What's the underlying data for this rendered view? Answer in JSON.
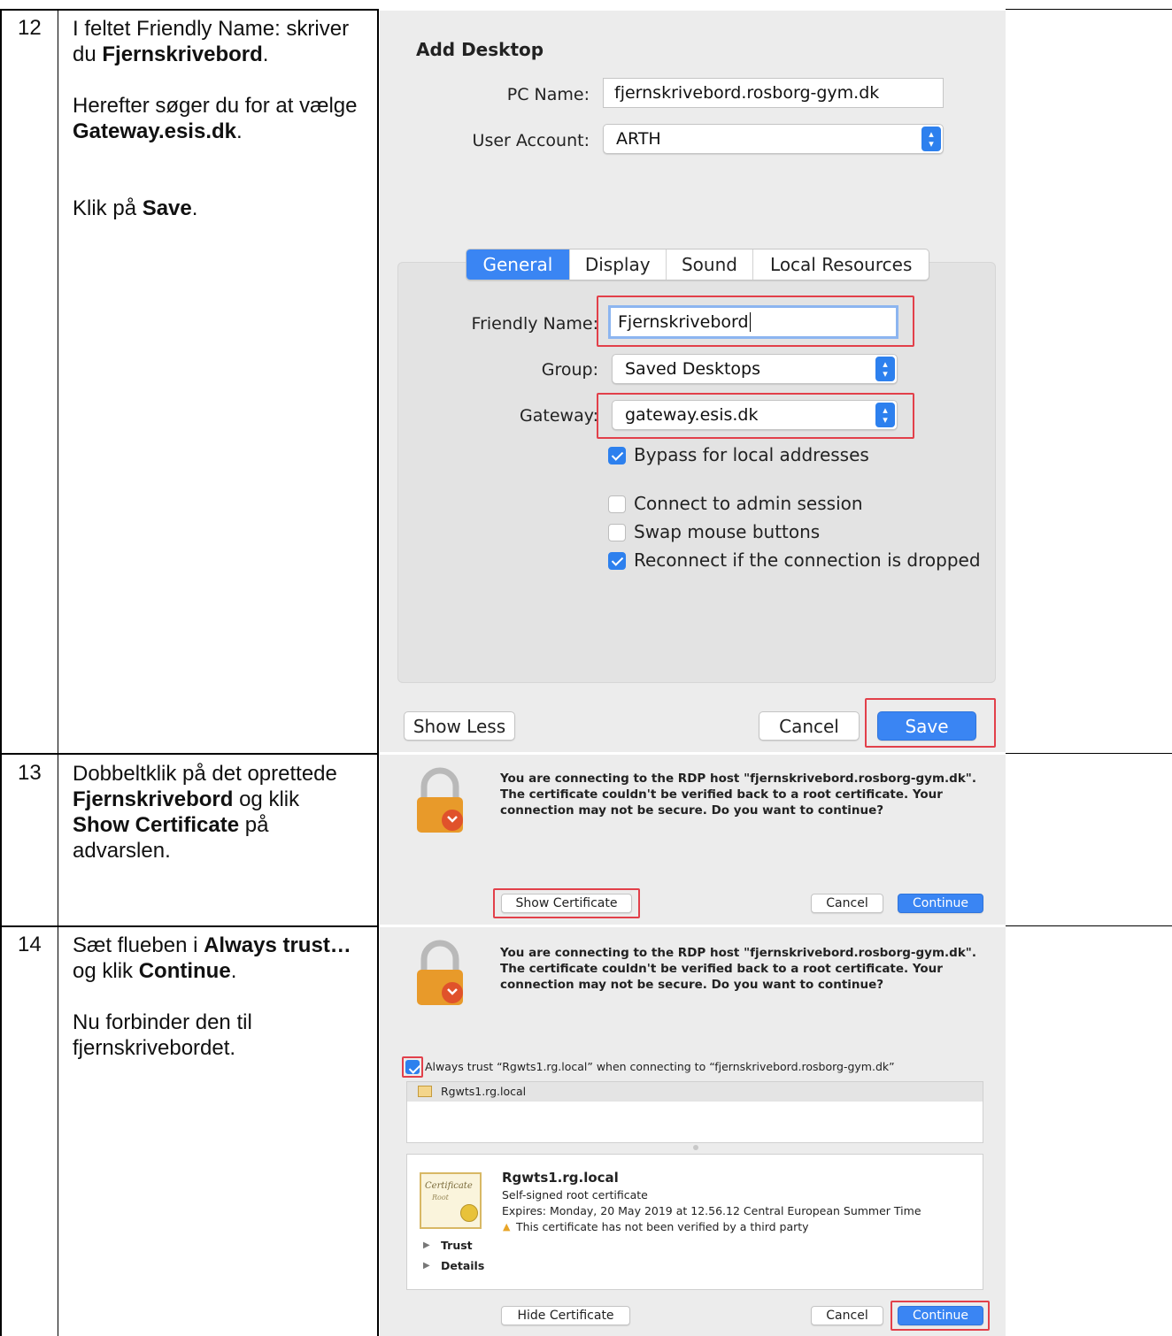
{
  "steps": [
    {
      "number": "12",
      "line1_prefix": "I feltet Friendly Name: skriver du ",
      "line1_bold": "Fjernskrivebord",
      "line1_suffix": ".",
      "line2_prefix": "Herefter søger du for at vælge ",
      "line2_bold": "Gateway.esis.dk",
      "line2_suffix": ".",
      "line3_prefix": "Klik på ",
      "line3_bold": "Save",
      "line3_suffix": "."
    },
    {
      "number": "13",
      "p1": "Dobbeltklik på det oprettede ",
      "b1": "Fjernskrivebord",
      "p2": " og klik ",
      "b2": "Show Certificate",
      "p3": " på advarslen."
    },
    {
      "number": "14",
      "p1": "Sæt flueben i ",
      "b1": "Always trust…",
      "p2": " og klik ",
      "b2": "Continue",
      "p3": ".",
      "line2": "Nu forbinder den til fjernskrivebordet."
    }
  ],
  "add_desktop": {
    "title": "Add Desktop",
    "pc_name_label": "PC Name:",
    "pc_name_value": "fjernskrivebord.rosborg-gym.dk",
    "user_account_label": "User Account:",
    "user_account_value": "ARTH",
    "tabs": [
      "General",
      "Display",
      "Sound",
      "Local Resources"
    ],
    "active_tab": "General",
    "friendly_name_label": "Friendly Name:",
    "friendly_name_value": "Fjernskrivebord",
    "group_label": "Group:",
    "group_value": "Saved Desktops",
    "gateway_label": "Gateway:",
    "gateway_value": "gateway.esis.dk",
    "checkboxes": [
      {
        "label": "Bypass for local addresses",
        "checked": true
      },
      {
        "label": "Connect to admin session",
        "checked": false
      },
      {
        "label": "Swap mouse buttons",
        "checked": false
      },
      {
        "label": "Reconnect if the connection is dropped",
        "checked": true
      }
    ],
    "show_less": "Show Less",
    "cancel": "Cancel",
    "save": "Save"
  },
  "cert_warning": {
    "message": "You are connecting to the RDP host \"fjernskrivebord.rosborg-gym.dk\". The certificate couldn't be verified back to a root certificate. Your connection may not be secure. Do you want to continue?",
    "show_certificate": "Show Certificate",
    "cancel": "Cancel",
    "continue": "Continue"
  },
  "cert_details": {
    "message": "You are connecting to the RDP host \"fjernskrivebord.rosborg-gym.dk\". The certificate couldn't be verified back to a root certificate. Your connection may not be secure. Do you want to continue?",
    "always_trust": "Always trust “Rgwts1.rg.local” when connecting to “fjernskrivebord.rosborg-gym.dk”",
    "always_trust_checked": true,
    "list_item": "Rgwts1.rg.local",
    "cert_name": "Rgwts1.rg.local",
    "cert_type": "Self-signed root certificate",
    "cert_expires": "Expires: Monday, 20 May 2019 at 12.56.12 Central European Summer Time",
    "cert_warning": "This certificate has not been verified by a third party",
    "cert_image_text": "Certificate",
    "cert_image_subtext": "Root",
    "trust": "Trust",
    "details": "Details",
    "hide_certificate": "Hide Certificate",
    "cancel": "Cancel",
    "continue": "Continue"
  },
  "colors": {
    "accent": "#3a85f3",
    "highlight_box": "#e2404a"
  }
}
